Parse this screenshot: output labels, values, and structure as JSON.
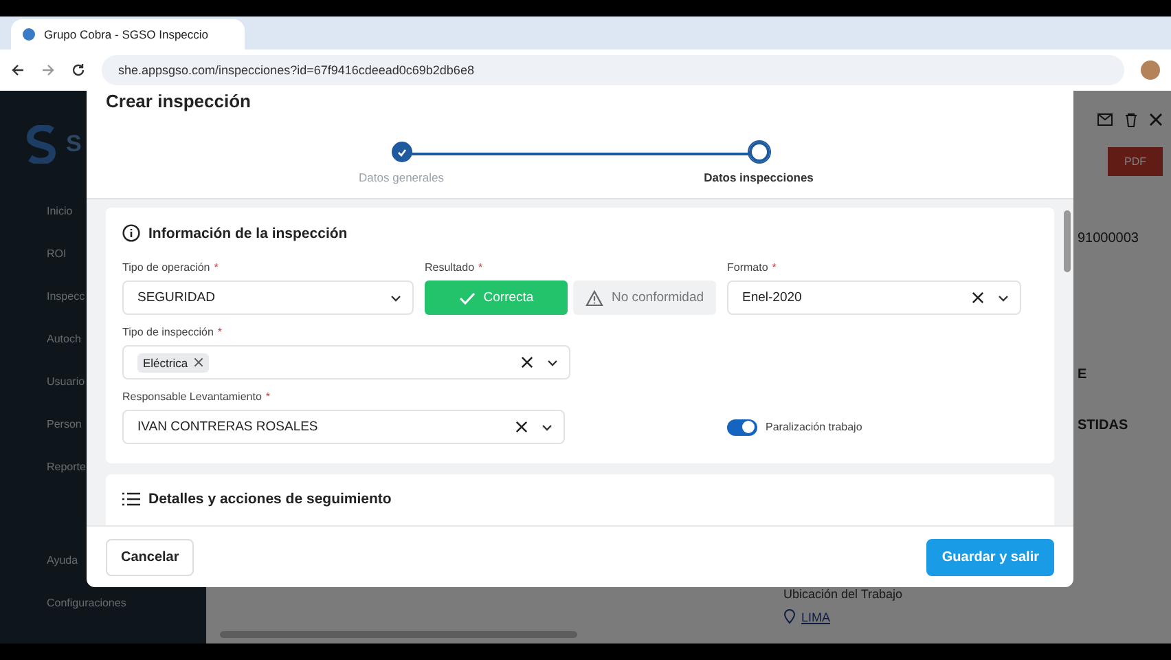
{
  "browser": {
    "tab_title": "Grupo Cobra - SGSO Inspeccio",
    "url": "she.appsgso.com/inspecciones?id=67f9416cdeead0c69b2db6e8"
  },
  "background": {
    "logo_text": "S",
    "sidebar_items": [
      "Inicio",
      "ROI",
      "Inspecc",
      "Autoch",
      "Usuario",
      "Person",
      "Reporte"
    ],
    "sidebar_footer": [
      "Ayuda",
      "Configuraciones"
    ],
    "pdf_button": "PDF",
    "code": "91000003",
    "right_texts": [
      "E",
      "STIDAS"
    ],
    "location_label": "Ubicación del Trabajo",
    "location_value": "LIMA"
  },
  "modal": {
    "title": "Crear inspección",
    "steps": [
      {
        "label": "Datos generales",
        "completed": true,
        "selected": false
      },
      {
        "label": "Datos inspecciones",
        "completed": false,
        "selected": true
      }
    ],
    "section_title": "Información de la inspección",
    "fields": [
      {
        "kind": "select",
        "label": "Tipo de operación",
        "required_mark": "*",
        "value": "SEGURIDAD",
        "clearable": false
      },
      {
        "kind": "result",
        "label": "Resultado",
        "required_mark": "*",
        "options": [
          {
            "label": "Correcta",
            "selected": true
          },
          {
            "label": "No conformidad",
            "selected": false
          }
        ]
      },
      {
        "kind": "select",
        "label": "Formato",
        "required_mark": "*",
        "value": "Enel-2020",
        "clearable": true
      },
      {
        "kind": "tags",
        "label": "Tipo de inspección",
        "required_mark": "*",
        "tags": [
          "Eléctrica"
        ]
      },
      {
        "kind": "select",
        "label": "Responsable Levantamiento",
        "required_mark": "*",
        "value": "IVAN CONTRERAS ROSALES",
        "clearable": true
      },
      {
        "kind": "toggle",
        "label": "Paralización trabajo",
        "on": true
      }
    ],
    "next_section_title": "Detalles y acciones de seguimiento",
    "cancel_button": "Cancelar",
    "save_button": "Guardar y salir"
  }
}
